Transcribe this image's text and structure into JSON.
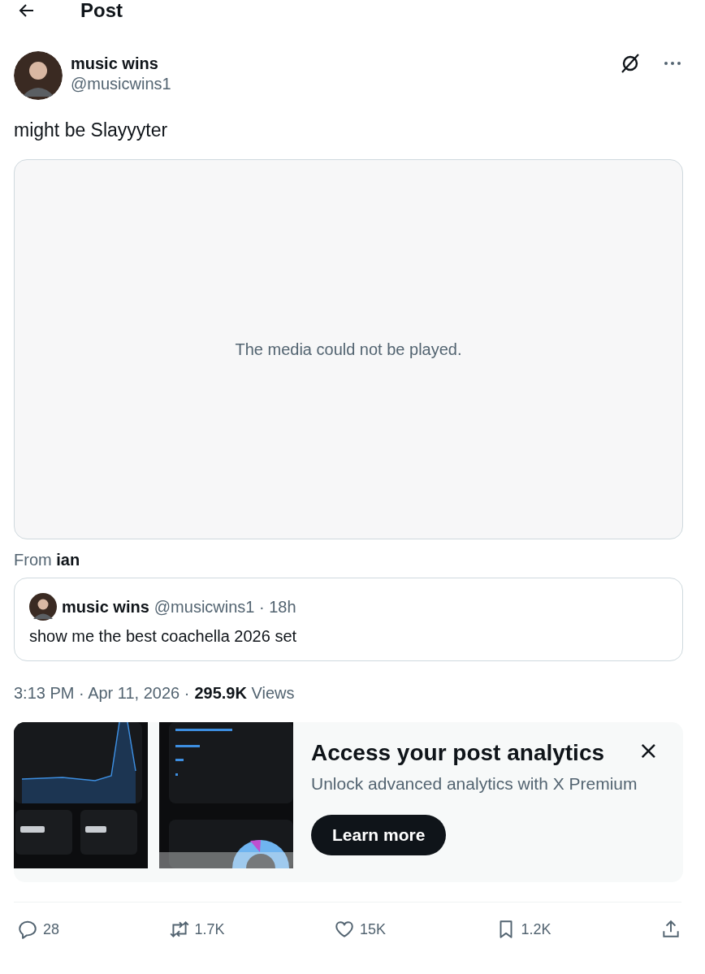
{
  "header": {
    "title": "Post"
  },
  "post": {
    "author": {
      "name": "music wins",
      "handle": "@musicwins1"
    },
    "text": "might be Slayyyter",
    "media": {
      "message": "The media could not be played."
    },
    "attribution": {
      "prefix": "From",
      "name": "ian"
    },
    "quote": {
      "name": "music wins",
      "handle": "@musicwins1",
      "time": "· 18h",
      "text": "show me the best coachella 2026 set"
    },
    "meta": {
      "time": "3:13 PM · Apr 11, 2026 ·",
      "views": "295.9K",
      "views_label": "Views"
    }
  },
  "promo": {
    "title": "Access your post analytics",
    "subtitle": "Unlock advanced analytics with X Premium",
    "button": "Learn more",
    "close": "×"
  },
  "actions": [
    {
      "kind": "reply",
      "count": "28"
    },
    {
      "kind": "repost",
      "count": "1.7K"
    },
    {
      "kind": "like",
      "count": "15K"
    },
    {
      "kind": "bookmark",
      "count": "1.2K"
    },
    {
      "kind": "share"
    }
  ]
}
